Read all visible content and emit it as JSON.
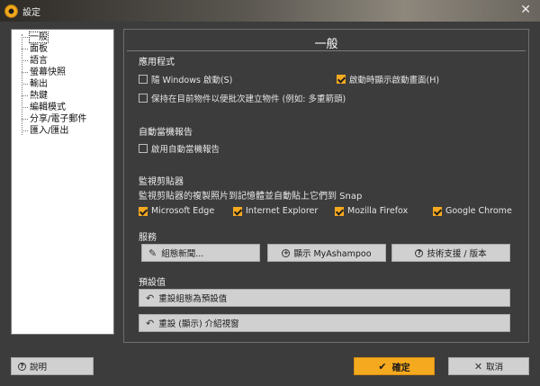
{
  "window": {
    "title": "設定",
    "close_glyph": "✕"
  },
  "sidebar": {
    "items": [
      {
        "label": "一般"
      },
      {
        "label": "面板"
      },
      {
        "label": "語言"
      },
      {
        "label": "螢幕快照"
      },
      {
        "label": "輸出"
      },
      {
        "label": "熱鍵"
      },
      {
        "label": "編輯模式"
      },
      {
        "label": "分享/電子郵件"
      },
      {
        "label": "匯入/匯出"
      }
    ]
  },
  "panel": {
    "title": "一般",
    "app": {
      "title": "應用程式",
      "start_with_windows": {
        "label": "隨 Windows 啟動(S)",
        "checked": false
      },
      "show_splash": {
        "label": "啟動時顯示啟動畫面(H)",
        "checked": true
      },
      "keep_objects": {
        "label": "保持在目前物件以便批次建立物件 (例如: 多重箭頭)",
        "checked": false
      }
    },
    "crash": {
      "title": "自動當機報告",
      "enable": {
        "label": "啟用自動當機報告",
        "checked": false
      }
    },
    "monitor": {
      "title": "監視剪貼器",
      "description": "監視剪貼器的複製照片到記憶體並自動貼上它們到 Snap",
      "edge": {
        "label": "Microsoft Edge",
        "checked": true
      },
      "ie": {
        "label": "Internet Explorer",
        "checked": true
      },
      "firefox": {
        "label": "Mozilla Firefox",
        "checked": true
      },
      "chrome": {
        "label": "Google Chrome",
        "checked": true
      }
    },
    "services": {
      "title": "服務",
      "news_button": "組態新聞...",
      "show_button": "顯示 MyAshampoo",
      "support_button": "技術支援 / 版本"
    },
    "defaults": {
      "title": "預設值",
      "reset_config_button": "重設組態為預設值",
      "reset_intro_button": "重設 (顯示) 介紹視窗"
    }
  },
  "footer": {
    "help_button": "說明",
    "confirm_button": "確定",
    "cancel_button": "取消"
  },
  "colors": {
    "accent": "#f5a91f",
    "background": "#3c3c3c"
  }
}
